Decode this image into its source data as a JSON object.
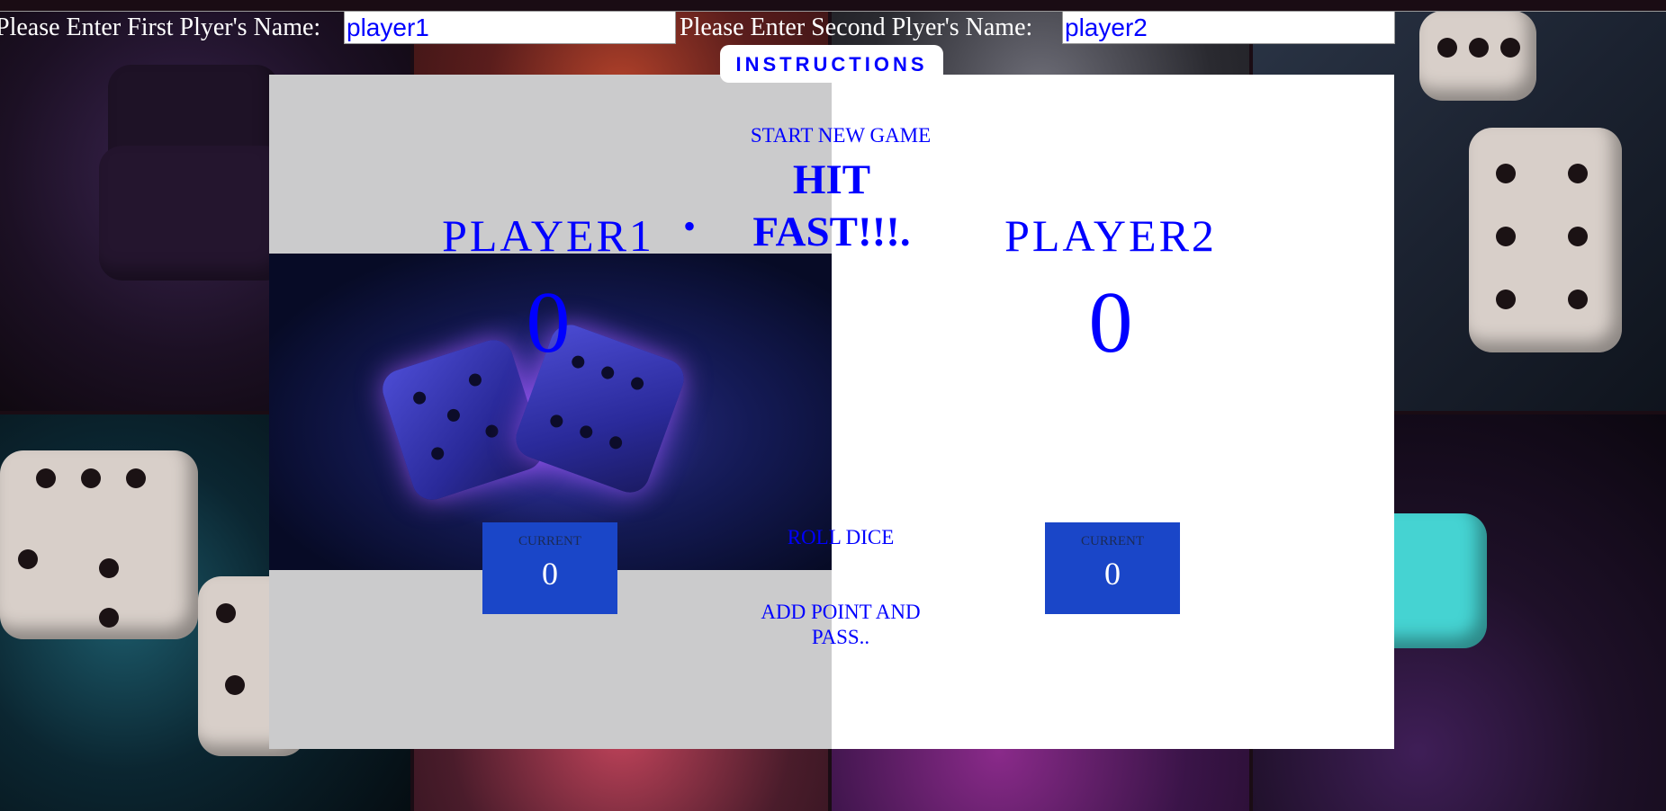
{
  "inputs": {
    "first_label": "Please Enter First Plyer's Name:",
    "first_value": "player1",
    "second_label": "Please Enter Second Plyer's Name:",
    "second_value": "player2"
  },
  "instructions_label": "INSTRUCTIONS",
  "controls": {
    "new_game": "START NEW GAME",
    "tagline": "HIT FAST!!!.",
    "roll": "ROLL DICE",
    "hold": "ADD POINT AND PASS.."
  },
  "players": [
    {
      "name": "PLAYER1",
      "score": "0",
      "current_label": "CURRENT",
      "current": "0"
    },
    {
      "name": "PLAYER2",
      "score": "0",
      "current_label": "CURRENT",
      "current": "0"
    }
  ],
  "active_indicator": "•",
  "colors": {
    "accent": "#0000ff",
    "current_box": "#1a46c8",
    "active_panel": "#cbcbcc",
    "inactive_panel": "#ffffff"
  }
}
